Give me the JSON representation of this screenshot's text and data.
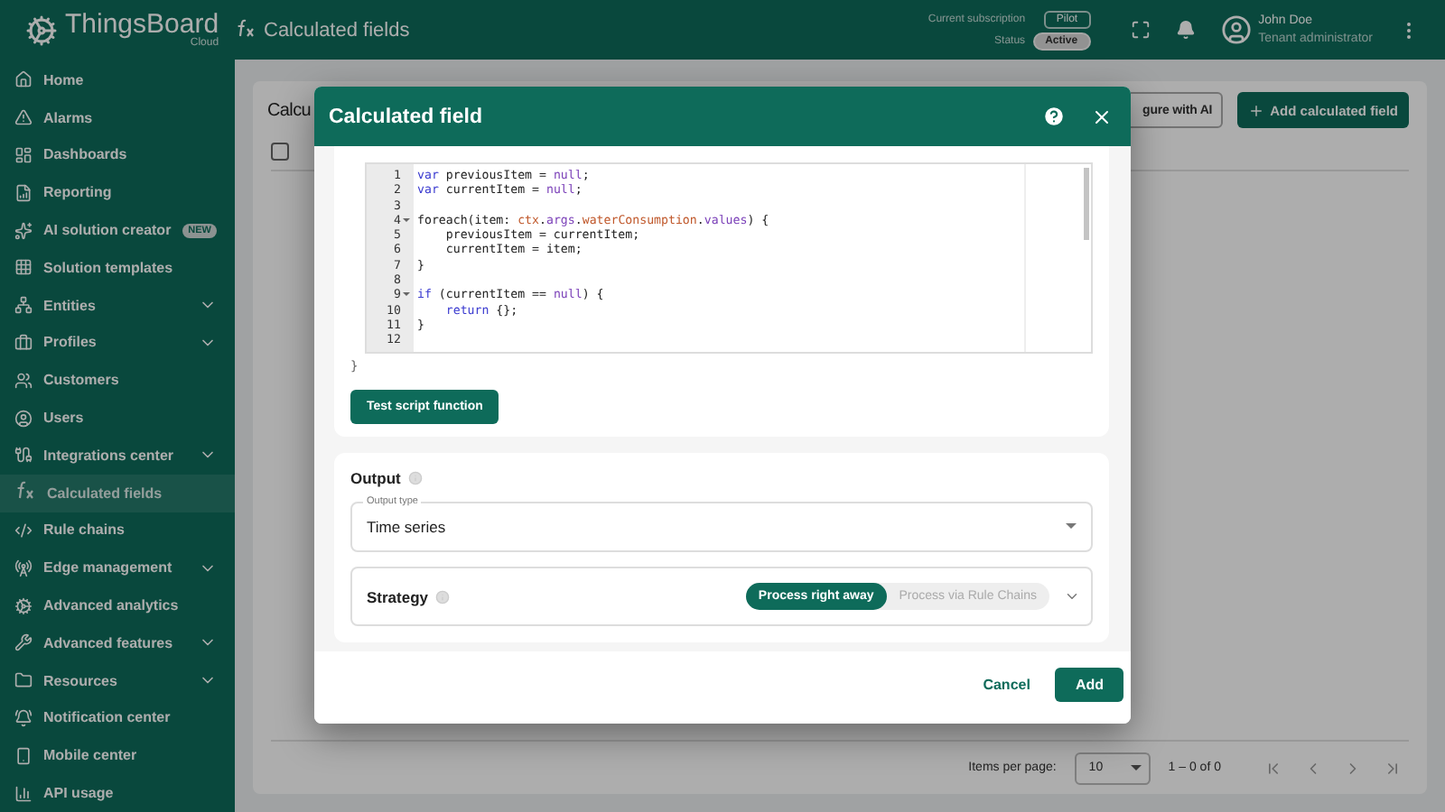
{
  "app": {
    "logo": "ThingsBoard",
    "edition": "Cloud",
    "page_title": "Calculated fields"
  },
  "header": {
    "subscription_label": "Current subscription",
    "subscription": "Pilot",
    "status_label": "Status",
    "status": "Active",
    "user_name": "John Doe",
    "user_role": "Tenant administrator"
  },
  "sidebar": {
    "items": [
      {
        "label": "Home",
        "expandable": false,
        "selected": false
      },
      {
        "label": "Alarms",
        "expandable": false,
        "selected": false
      },
      {
        "label": "Dashboards",
        "expandable": false,
        "selected": false
      },
      {
        "label": "Reporting",
        "expandable": false,
        "selected": false
      },
      {
        "label": "AI solution creator",
        "expandable": false,
        "selected": false,
        "badge": "NEW"
      },
      {
        "label": "Solution templates",
        "expandable": false,
        "selected": false
      },
      {
        "label": "Entities",
        "expandable": true,
        "selected": false
      },
      {
        "label": "Profiles",
        "expandable": true,
        "selected": false
      },
      {
        "label": "Customers",
        "expandable": false,
        "selected": false
      },
      {
        "label": "Users",
        "expandable": false,
        "selected": false
      },
      {
        "label": "Integrations center",
        "expandable": true,
        "selected": false
      },
      {
        "label": "Calculated fields",
        "expandable": false,
        "selected": true
      },
      {
        "label": "Rule chains",
        "expandable": false,
        "selected": false
      },
      {
        "label": "Edge management",
        "expandable": true,
        "selected": false
      },
      {
        "label": "Advanced analytics",
        "expandable": false,
        "selected": false
      },
      {
        "label": "Advanced features",
        "expandable": true,
        "selected": false
      },
      {
        "label": "Resources",
        "expandable": true,
        "selected": false
      },
      {
        "label": "Notification center",
        "expandable": false,
        "selected": false
      },
      {
        "label": "Mobile center",
        "expandable": false,
        "selected": false
      },
      {
        "label": "API usage",
        "expandable": false,
        "selected": false
      }
    ]
  },
  "page": {
    "title": "Calcu",
    "ai_button": "gure with AI",
    "add_button": "Add calculated field",
    "select_all_checked": false,
    "pagination": {
      "items_per_page_label": "Items per page:",
      "items_per_page": "10",
      "range": "1 – 0 of 0"
    }
  },
  "dialog": {
    "title": "Calculated field",
    "code": [
      {
        "number": "1",
        "fold": false,
        "tokens": [
          {
            "text": "var",
            "kind": "keyword"
          },
          {
            "text": " previousItem = ",
            "kind": "plain"
          },
          {
            "text": "null",
            "kind": "constant"
          },
          {
            "text": ";",
            "kind": "plain"
          }
        ]
      },
      {
        "number": "2",
        "fold": false,
        "tokens": [
          {
            "text": "var",
            "kind": "keyword"
          },
          {
            "text": " currentItem = ",
            "kind": "plain"
          },
          {
            "text": "null",
            "kind": "constant"
          },
          {
            "text": ";",
            "kind": "plain"
          }
        ]
      },
      {
        "number": "3",
        "fold": false
      },
      {
        "number": "4",
        "fold": true,
        "tokens": [
          {
            "text": "foreach(item: ",
            "kind": "plain"
          },
          {
            "text": "ctx",
            "kind": "variable"
          },
          {
            "text": ".",
            "kind": "plain"
          },
          {
            "text": "args",
            "kind": "property"
          },
          {
            "text": ".",
            "kind": "plain"
          },
          {
            "text": "waterConsumption",
            "kind": "variable"
          },
          {
            "text": ".",
            "kind": "plain"
          },
          {
            "text": "values",
            "kind": "property"
          },
          {
            "text": ") {",
            "kind": "plain"
          }
        ]
      },
      {
        "number": "5",
        "fold": false,
        "tokens": [
          {
            "text": "    previousItem = currentItem;",
            "kind": "plain"
          }
        ]
      },
      {
        "number": "6",
        "fold": false,
        "tokens": [
          {
            "text": "    currentItem = item;",
            "kind": "plain"
          }
        ]
      },
      {
        "number": "7",
        "fold": false,
        "tokens": [
          {
            "text": "}",
            "kind": "plain"
          }
        ]
      },
      {
        "number": "8",
        "fold": false
      },
      {
        "number": "9",
        "fold": true,
        "tokens": [
          {
            "text": "if",
            "kind": "keyword"
          },
          {
            "text": " (currentItem == ",
            "kind": "plain"
          },
          {
            "text": "null",
            "kind": "constant"
          },
          {
            "text": ") {",
            "kind": "plain"
          }
        ]
      },
      {
        "number": "10",
        "fold": false,
        "tokens": [
          {
            "text": "    return",
            "kind": "keyword"
          },
          {
            "text": " {};",
            "kind": "plain"
          }
        ]
      },
      {
        "number": "11",
        "fold": false,
        "tokens": [
          {
            "text": "}",
            "kind": "plain"
          }
        ]
      },
      {
        "number": "12",
        "fold": false
      }
    ],
    "closing_brace": "}",
    "test_button": "Test script function",
    "output": {
      "title": "Output",
      "type_label": "Output type",
      "type_value": "Time series",
      "strategy_label": "Strategy",
      "strategy_options": [
        {
          "label": "Process right away",
          "selected": true
        },
        {
          "label": "Process via Rule Chains",
          "selected": false
        }
      ]
    },
    "cancel": "Cancel",
    "add": "Add"
  }
}
